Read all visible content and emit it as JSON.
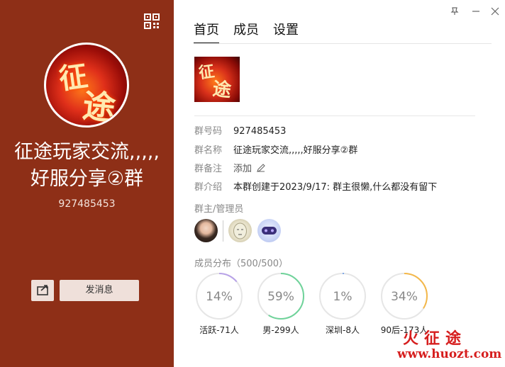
{
  "left_panel": {
    "title_line1": "征途玩家交流,,,,,",
    "title_line2": "好服分享②群",
    "group_id": "927485453",
    "send_message_label": "发消息",
    "bg_color": "#8e2f17",
    "avatar_glyph1": "征",
    "avatar_glyph2": "途"
  },
  "window_controls": {
    "pin": "pin-icon",
    "minimize": "minimize-icon",
    "close": "close-icon"
  },
  "tabs": [
    {
      "label": "首页",
      "active": true
    },
    {
      "label": "成员",
      "active": false
    },
    {
      "label": "设置",
      "active": false
    }
  ],
  "thumb": {
    "glyph1": "征",
    "glyph2": "途"
  },
  "info": {
    "id_label": "群号码",
    "id_value": "927485453",
    "name_label": "群名称",
    "name_value": "征途玩家交流,,,,,好服分享②群",
    "remark_label": "群备注",
    "remark_value": "添加",
    "intro_label": "群介绍",
    "intro_value": "本群创建于2023/9/17:  群主很懒,什么都没有留下"
  },
  "admins": {
    "label": "群主/管理员",
    "count": 3
  },
  "distribution": {
    "label": "成员分布（500/500）",
    "rings": [
      {
        "percent_text": "14%",
        "fraction": 0.14,
        "caption": "活跃-71人",
        "color": "#b8a2e8"
      },
      {
        "percent_text": "59%",
        "fraction": 0.59,
        "caption": "男-299人",
        "color": "#6fd39a"
      },
      {
        "percent_text": "1%",
        "fraction": 0.01,
        "caption": "深圳-8人",
        "color": "#7fa8e8"
      },
      {
        "percent_text": "34%",
        "fraction": 0.34,
        "caption": "90后-173人",
        "color": "#f4b84a"
      }
    ]
  },
  "watermark": {
    "top": "火征途",
    "bottom": "www.huozt.com"
  }
}
